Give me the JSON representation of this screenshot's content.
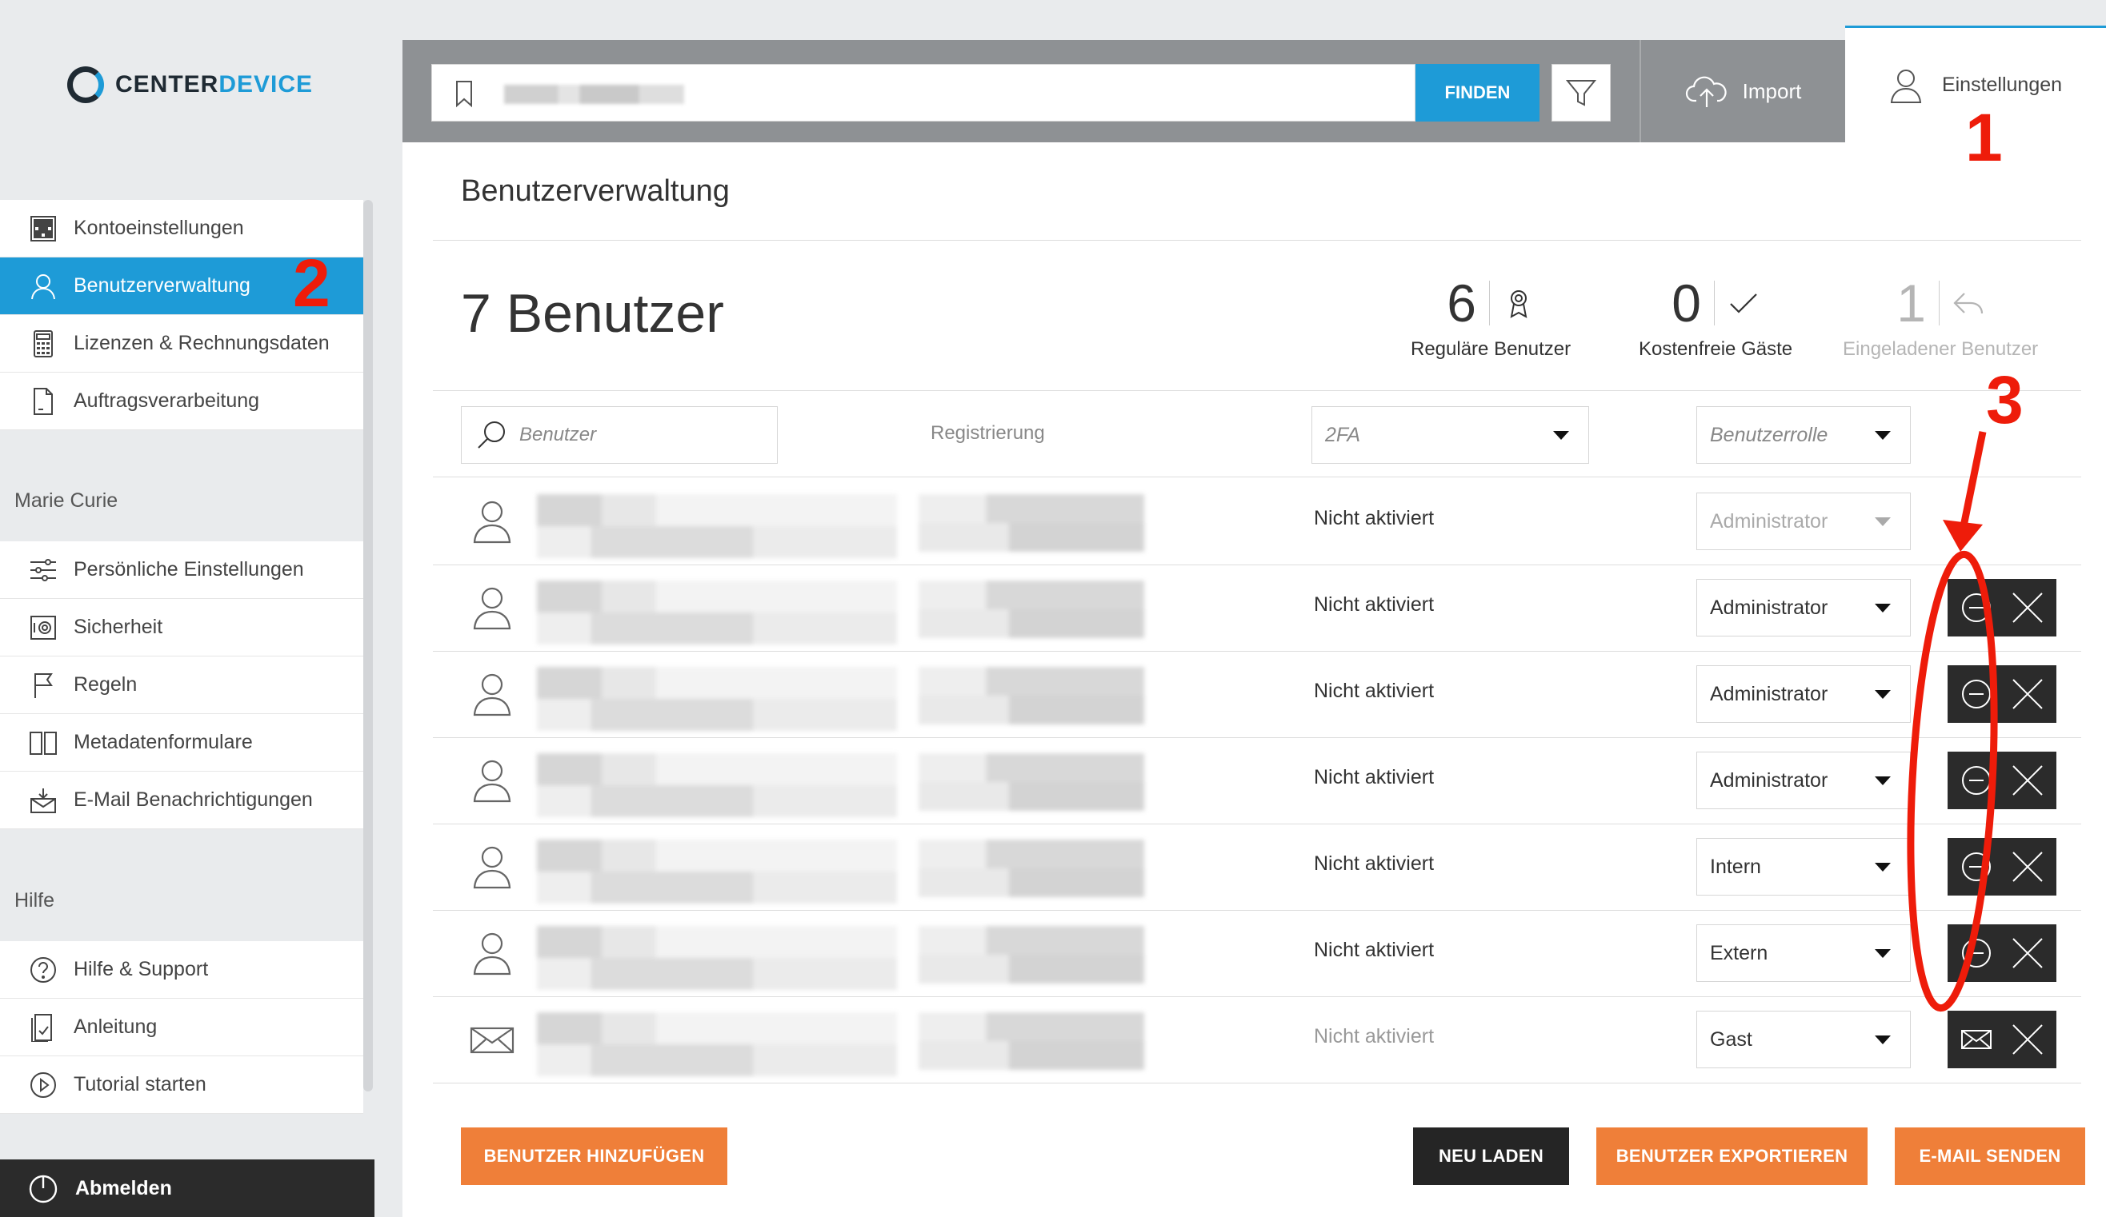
{
  "brand": {
    "name_part1": "CENTER",
    "name_part2": "DEVICE"
  },
  "sidebar": {
    "account_items": [
      {
        "label": "Kontoeinstellungen",
        "icon": "grid-icon"
      },
      {
        "label": "Benutzerverwaltung",
        "icon": "user-icon"
      },
      {
        "label": "Lizenzen & Rechnungsdaten",
        "icon": "calculator-icon"
      },
      {
        "label": "Auftragsverarbeitung",
        "icon": "document-icon"
      }
    ],
    "personal_section_title": "Marie Curie",
    "personal_items": [
      {
        "label": "Persönliche Einstellungen",
        "icon": "sliders-icon"
      },
      {
        "label": "Sicherheit",
        "icon": "safe-icon"
      },
      {
        "label": "Regeln",
        "icon": "flag-icon"
      },
      {
        "label": "Metadatenformulare",
        "icon": "book-icon"
      },
      {
        "label": "E-Mail Benachrichtigungen",
        "icon": "mail-inbox-icon"
      }
    ],
    "help_section_title": "Hilfe",
    "help_items": [
      {
        "label": "Hilfe & Support",
        "icon": "question-icon"
      },
      {
        "label": "Anleitung",
        "icon": "manual-icon"
      },
      {
        "label": "Tutorial starten",
        "icon": "play-icon"
      }
    ],
    "logout_label": "Abmelden"
  },
  "topbar": {
    "find_label": "FINDEN",
    "import_label": "Import",
    "settings_label": "Einstellungen"
  },
  "main": {
    "page_title": "Benutzerverwaltung",
    "user_count_label": "7 Benutzer",
    "stats": [
      {
        "value": "6",
        "label": "Reguläre Benutzer",
        "icon": "ribbon-icon"
      },
      {
        "value": "0",
        "label": "Kostenfreie Gäste",
        "icon": "check-icon"
      },
      {
        "value": "1",
        "label": "Eingeladener Benutzer",
        "icon": "reply-icon"
      }
    ],
    "filters": {
      "search_placeholder": "Benutzer",
      "registration_label": "Registrierung",
      "twofa_placeholder": "2FA",
      "role_placeholder": "Benutzerrolle"
    },
    "users": [
      {
        "twofa": "Nicht aktiviert",
        "role": "Administrator",
        "type": "user",
        "editable": false
      },
      {
        "twofa": "Nicht aktiviert",
        "role": "Administrator",
        "type": "user",
        "editable": true
      },
      {
        "twofa": "Nicht aktiviert",
        "role": "Administrator",
        "type": "user",
        "editable": true
      },
      {
        "twofa": "Nicht aktiviert",
        "role": "Administrator",
        "type": "user",
        "editable": true
      },
      {
        "twofa": "Nicht aktiviert",
        "role": "Intern",
        "type": "user",
        "editable": true
      },
      {
        "twofa": "Nicht aktiviert",
        "role": "Extern",
        "type": "user",
        "editable": true
      },
      {
        "twofa": "Nicht aktiviert",
        "role": "Gast",
        "type": "invite",
        "editable": true
      }
    ],
    "buttons": {
      "add_user": "BENUTZER HINZUFÜGEN",
      "reload": "NEU LADEN",
      "export": "BENUTZER EXPORTIEREN",
      "send_email": "E-MAIL SENDEN"
    }
  },
  "annotations": {
    "one": "1",
    "two": "2",
    "three": "3",
    "color": "#ee1c0a"
  },
  "colors": {
    "accent": "#1e9bd7",
    "orange": "#ef7f39",
    "dark": "#252525",
    "topbar": "#8e9194"
  }
}
